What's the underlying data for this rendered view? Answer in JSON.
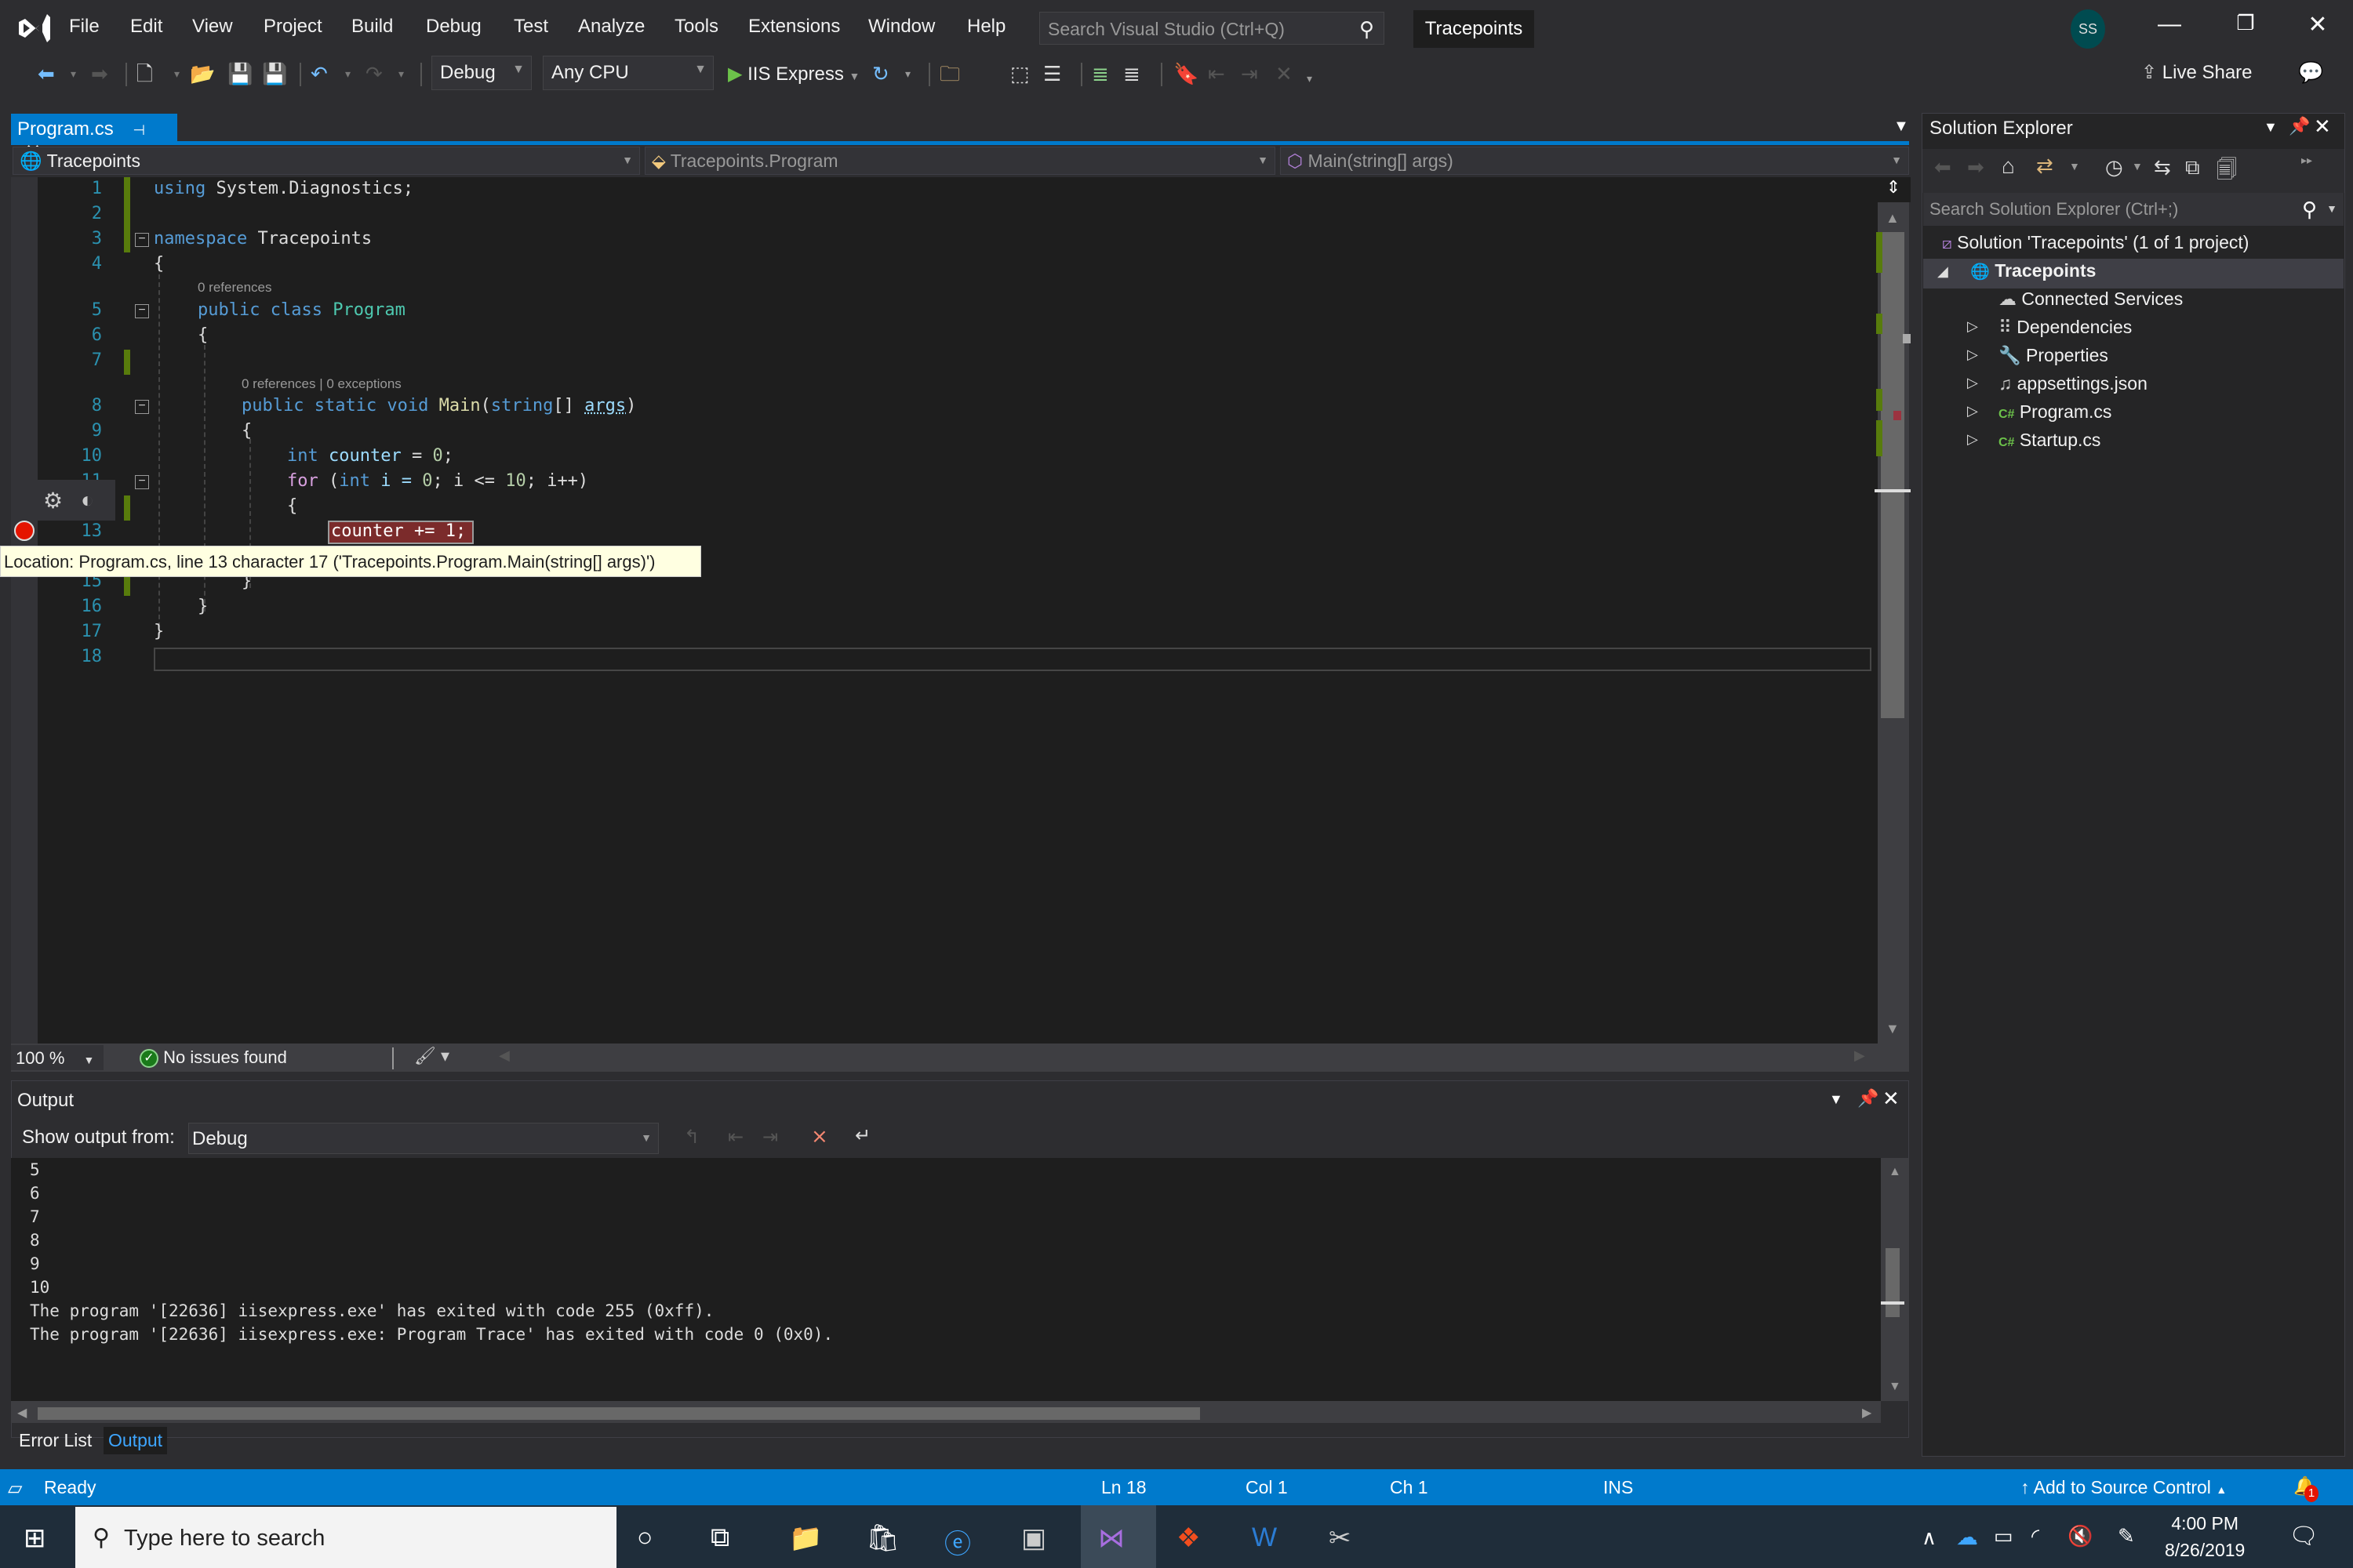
{
  "title_bar": {
    "menu": [
      "File",
      "Edit",
      "View",
      "Project",
      "Build",
      "Debug",
      "Test",
      "Analyze",
      "Tools",
      "Extensions",
      "Window",
      "Help"
    ],
    "search_placeholder": "Search Visual Studio (Ctrl+Q)",
    "project_title": "Tracepoints",
    "avatar_initials": "SS"
  },
  "toolbar": {
    "configuration": "Debug",
    "platform": "Any CPU",
    "run_target": "IIS Express",
    "live_share": "Live Share"
  },
  "editor": {
    "tab_label": "Program.cs",
    "nav_project": "Tracepoints",
    "nav_type": "Tracepoints.Program",
    "nav_member": "Main(string[] args)",
    "codelens": {
      "class_refs": "0 references",
      "main_refs": "0 references | 0 exceptions"
    },
    "lines": {
      "l1_kw": "using",
      "l1_rest": " System.Diagnostics;",
      "l3_kw": "namespace",
      "l3_rest": " Tracepoints",
      "brace_open": "{",
      "brace_close": "}",
      "l5_kw": "public class",
      "l5_type": "Program",
      "l8_kw": "public static void",
      "l8_fn": "Main",
      "l8_p1": "(",
      "l8_kw2": "string",
      "l8_p2": "[] ",
      "l8_param": "args",
      "l8_p3": ")",
      "l10_kw": "int",
      "l10_var": "counter",
      "l10_rest": " = ",
      "l10_num": "0",
      "l10_end": ";",
      "l11_kw": "for",
      "l11_a": " (",
      "l11_kw2": "int",
      "l11_b": " i = ",
      "l11_n1": "0",
      "l11_c": "; i <= ",
      "l11_n2": "10",
      "l11_d": "; i++)",
      "l13": "counter += 1;"
    },
    "line_numbers": [
      "1",
      "2",
      "3",
      "4",
      "5",
      "6",
      "7",
      "8",
      "9",
      "10",
      "11",
      "13",
      "15",
      "16",
      "17",
      "18"
    ],
    "tooltip": "Location: Program.cs, line 13 character 17 ('Tracepoints.Program.Main(string[] args)')",
    "zoom_level": "100 %",
    "issues_status": "No issues found"
  },
  "output_panel": {
    "title": "Output",
    "show_output_label": "Show output from:",
    "source": "Debug",
    "lines": [
      "5",
      "6",
      "7",
      "8",
      "9",
      "10",
      "The program '[22636] iisexpress.exe' has exited with code 255 (0xff).",
      "The program '[22636] iisexpress.exe: Program Trace' has exited with code 0 (0x0)."
    ],
    "tabs": [
      "Error List",
      "Output"
    ]
  },
  "solution_explorer": {
    "title": "Solution Explorer",
    "search_placeholder": "Search Solution Explorer (Ctrl+;)",
    "solution": "Solution 'Tracepoints' (1 of 1 project)",
    "project": "Tracepoints",
    "items": [
      "Connected Services",
      "Dependencies",
      "Properties",
      "appsettings.json",
      "Program.cs",
      "Startup.cs"
    ]
  },
  "status_bar": {
    "state": "Ready",
    "line": "Ln 18",
    "col": "Col 1",
    "ch": "Ch 1",
    "mode": "INS",
    "source_control": "Add to Source Control",
    "notification_count": "1"
  },
  "taskbar": {
    "search_placeholder": "Type here to search",
    "time": "4:00 PM",
    "date": "8/26/2019"
  },
  "colors": {
    "accent": "#007acc",
    "breakpoint": "#e51400",
    "tracepoint_highlight": "#7b2b2b",
    "keyword": "#569cd6",
    "type": "#4ec9b0"
  }
}
